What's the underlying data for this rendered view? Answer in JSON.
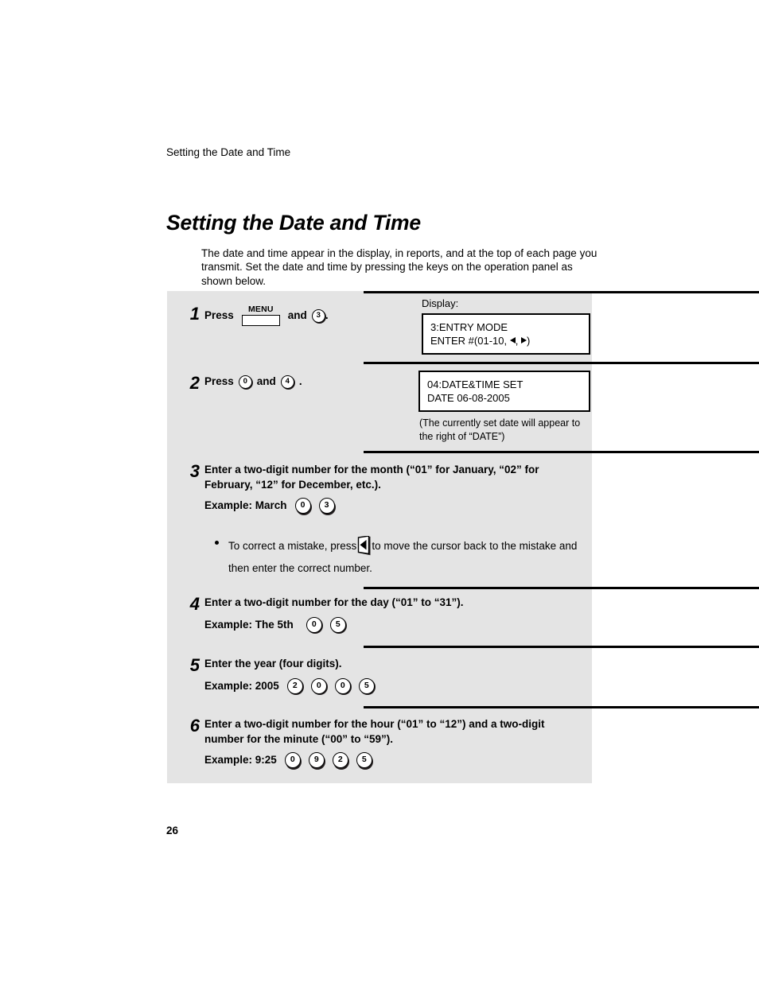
{
  "page": {
    "running_header": "Setting the Date and Time",
    "title": "Setting the Date and Time",
    "intro": "The date and time appear in the display, in reports, and at the top of each page you transmit. Set the date and time by pressing the keys on the operation panel as shown below.",
    "page_number": "26",
    "panel_bg": "#e4e4e4"
  },
  "steps": {
    "s1": {
      "num": "1",
      "press_label": "Press",
      "menu_key": "MENU",
      "and_label": "and",
      "key3": "3",
      "period": ".",
      "display_label": "Display:",
      "lcd_line1": "3:ENTRY MODE",
      "lcd_line2_pre": "ENTER #(01-10,",
      "lcd_line2_mid": ",",
      "lcd_line2_post": ")"
    },
    "s2": {
      "num": "2",
      "press_label": "Press",
      "key0": "0",
      "and_label": "and",
      "key4": "4",
      "period": ".",
      "lcd_line1": "04:DATE&TIME SET",
      "lcd_line2": "DATE 06-08-2005",
      "caption": "(The currently set date will appear to the right of “DATE”)"
    },
    "s3": {
      "num": "3",
      "line1": "Enter a two-digit number for the month (“01” for January, “02” for",
      "line2": "February, “12” for December, etc.).",
      "example_label": "Example: March",
      "key_a": "0",
      "key_b": "3",
      "note_pre": "To correct a mistake, press",
      "note_post": "to move the cursor back to the mistake and",
      "note_line2": "then enter the correct number."
    },
    "s4": {
      "num": "4",
      "line1": "Enter a two-digit number for the day (“01” to “31”).",
      "example_label": "Example: The 5th",
      "key_a": "0",
      "key_b": "5"
    },
    "s5": {
      "num": "5",
      "line1": "Enter the year (four digits).",
      "example_label": "Example: 2005",
      "key_a": "2",
      "key_b": "0",
      "key_c": "0",
      "key_d": "5"
    },
    "s6": {
      "num": "6",
      "line1": "Enter a two-digit number for the hour (“01” to “12”) and a two-digit",
      "line2": "number for the minute (“00” to “59”).",
      "example_label": "Example: 9:25",
      "key_a": "0",
      "key_b": "9",
      "key_c": "2",
      "key_d": "5"
    }
  }
}
